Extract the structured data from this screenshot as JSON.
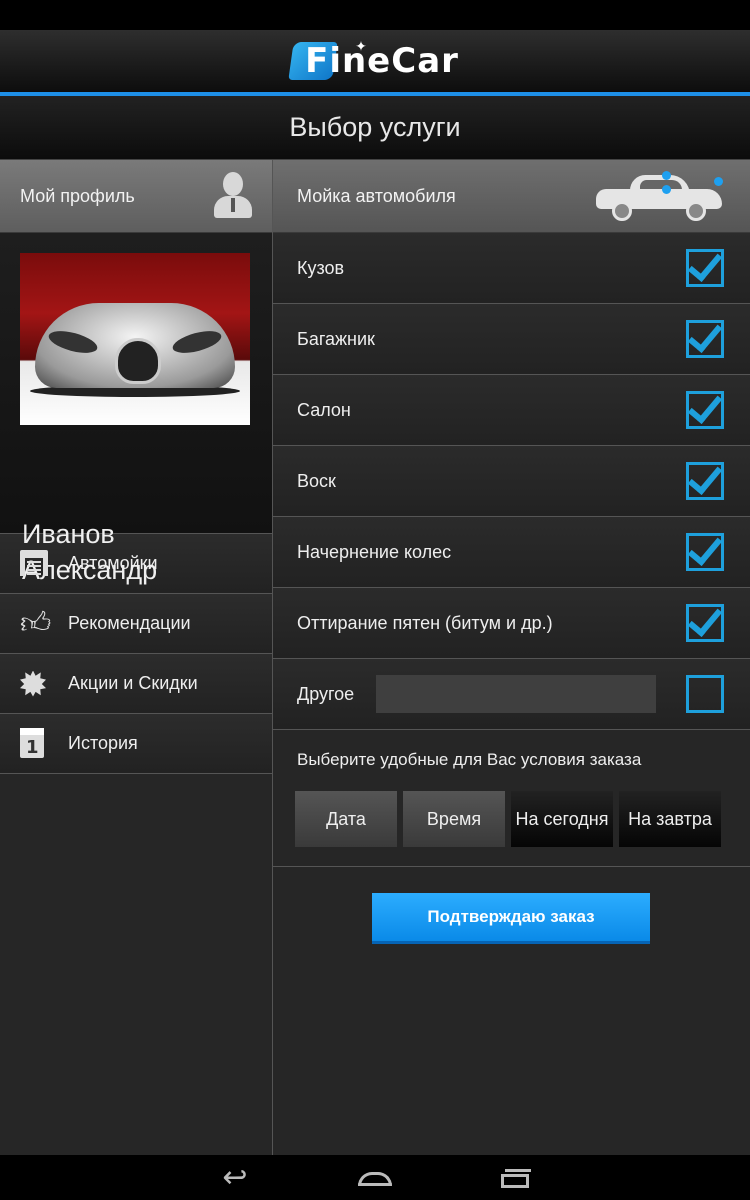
{
  "app": {
    "logo_text": "FineCar",
    "screen_title": "Выбор услуги",
    "accent_color": "#1e90e8"
  },
  "profile": {
    "header_label": "Мой профиль",
    "first_line_name": "Иванов",
    "second_line_name": "Александр"
  },
  "menu": {
    "items": [
      {
        "label": "Автомойки",
        "icon": "garage-icon"
      },
      {
        "label": "Рекомендации",
        "icon": "thumbs-up-icon"
      },
      {
        "label": "Акции и Скидки",
        "icon": "starburst-icon"
      },
      {
        "label": "История",
        "icon": "calendar-icon"
      }
    ]
  },
  "service": {
    "header_label": "Мойка автомобиля",
    "items": [
      {
        "label": "Кузов",
        "checked": true
      },
      {
        "label": "Багажник",
        "checked": true
      },
      {
        "label": "Салон",
        "checked": true
      },
      {
        "label": "Воск",
        "checked": true
      },
      {
        "label": "Начернение колес",
        "checked": true
      },
      {
        "label": "Оттирание пятен (битум и др.)",
        "checked": true
      }
    ],
    "other": {
      "label": "Другое",
      "value": "",
      "placeholder": "",
      "checked": false
    }
  },
  "conditions": {
    "title": "Выберите удобные для Вас условия заказа",
    "buttons": [
      "Дата",
      "Время",
      "На сегодня",
      "На завтра"
    ]
  },
  "confirm_label": "Подтверждаю заказ",
  "nav": {
    "back_icon": "back-icon",
    "home_icon": "home-icon",
    "recent_icon": "recent-apps-icon"
  }
}
